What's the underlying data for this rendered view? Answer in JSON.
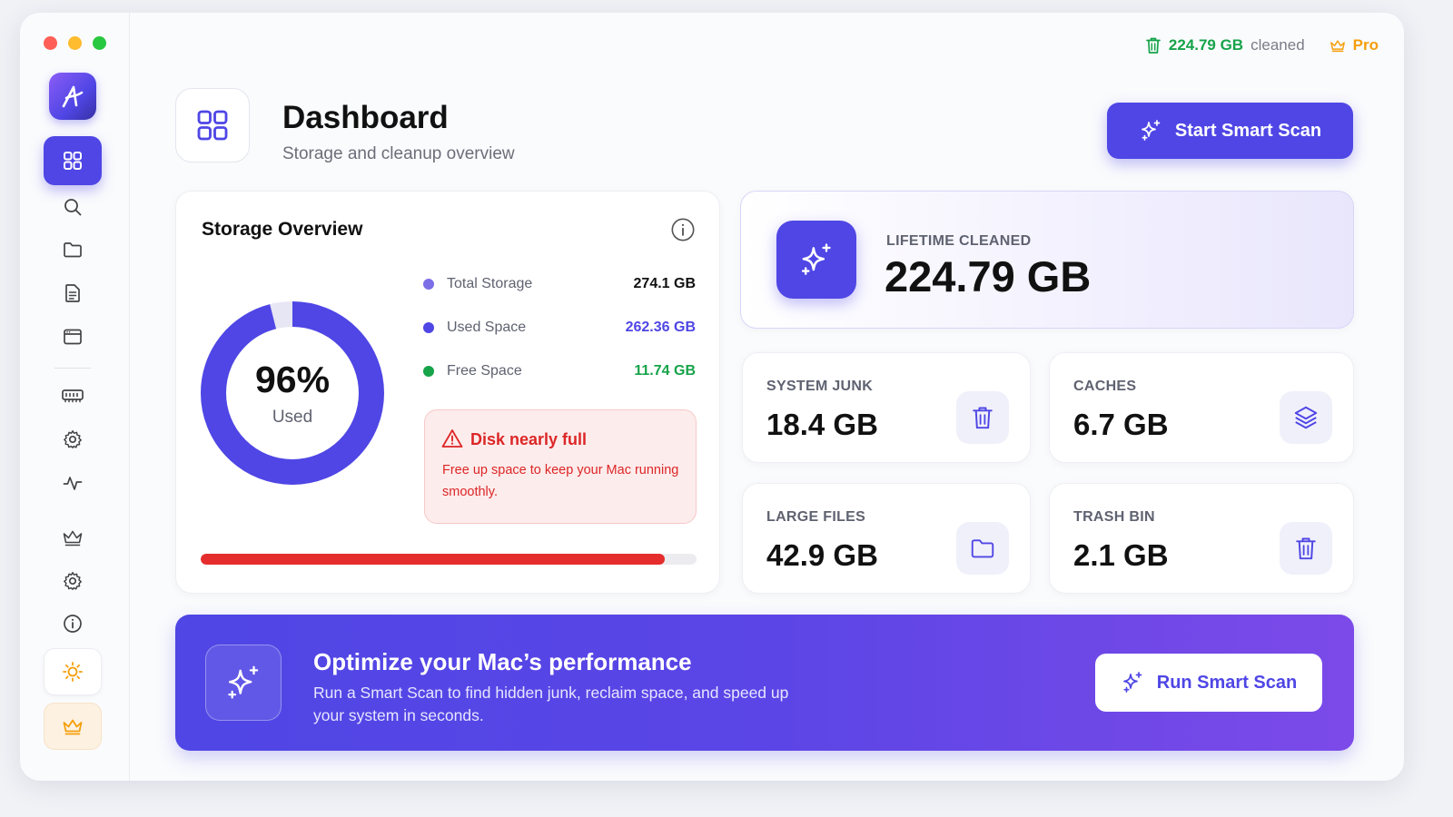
{
  "status": {
    "cleaned_value": "224.79 GB",
    "cleaned_suffix": "cleaned",
    "pro_label": "Pro"
  },
  "header": {
    "title": "Dashboard",
    "subtitle": "Storage and cleanup overview",
    "scan_button": "Start Smart Scan"
  },
  "storage": {
    "title": "Storage Overview",
    "used_percent_label": "96%",
    "used_percent_value": 96,
    "used_caption": "Used",
    "rows": [
      {
        "label": "Total Storage",
        "value": "274.1 GB",
        "color": "#7c6ee6"
      },
      {
        "label": "Used Space",
        "value": "262.36 GB",
        "color": "#4f46e5"
      },
      {
        "label": "Free Space",
        "value": "11.74 GB",
        "color": "#16a34a"
      }
    ],
    "alert": {
      "title": "Disk nearly full",
      "text": "Free up space to keep your Mac running smoothly."
    },
    "bar_fill_fraction": 0.935
  },
  "lifetime": {
    "label": "LIFETIME CLEANED",
    "value": "224.79 GB"
  },
  "stats": [
    {
      "label": "SYSTEM JUNK",
      "value": "18.4 GB",
      "icon": "trash-icon"
    },
    {
      "label": "CACHES",
      "value": "6.7 GB",
      "icon": "layers-icon"
    },
    {
      "label": "LARGE FILES",
      "value": "42.9 GB",
      "icon": "folder-icon"
    },
    {
      "label": "TRASH BIN",
      "value": "2.1 GB",
      "icon": "trash-icon"
    }
  ],
  "banner": {
    "title": "Optimize your Mac’s performance",
    "text": "Run a Smart Scan to find hidden junk, reclaim space, and speed up your system in seconds.",
    "button": "Run Smart Scan"
  },
  "sidebar": {
    "items": [
      "dashboard",
      "search",
      "folder",
      "document",
      "window",
      "memory",
      "settings-cog",
      "activity",
      "crown",
      "settings",
      "info"
    ],
    "active": "dashboard"
  },
  "colors": {
    "accent": "#4f46e5",
    "success": "#16a34a",
    "danger": "#dc2626",
    "pro": "#f59e0b"
  }
}
